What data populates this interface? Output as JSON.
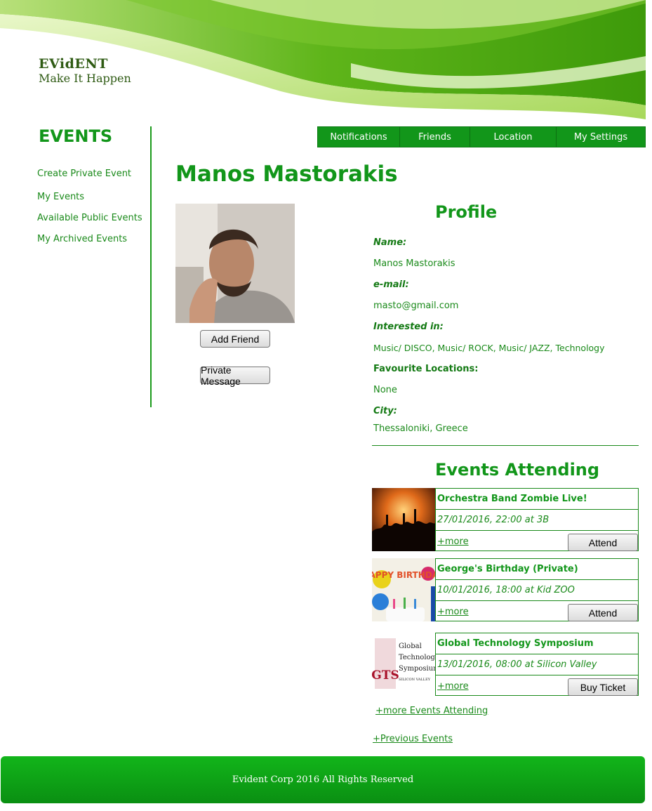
{
  "brand": {
    "name": "EVidENT",
    "tagline": "Make It Happen"
  },
  "sidebar": {
    "title": "EVENTS",
    "items": [
      {
        "label": "Create Private Event"
      },
      {
        "label": "My Events"
      },
      {
        "label": "Available Public Events"
      },
      {
        "label": "My Archived Events"
      }
    ]
  },
  "nav": {
    "items": [
      {
        "label": "Notifications"
      },
      {
        "label": "Friends"
      },
      {
        "label": "Location"
      },
      {
        "label": "My Settings"
      }
    ]
  },
  "user": {
    "name": "Manos Mastorakis",
    "add_friend_label": "Add Friend",
    "private_message_label": "Private Message"
  },
  "profile": {
    "title": "Profile",
    "fields": [
      {
        "label": "Name:",
        "value": "Manos Mastorakis"
      },
      {
        "label": "e-mail:",
        "value": "masto@gmail.com"
      },
      {
        "label": "Interested in:",
        "value": "Music/ DISCO, Music/ ROCK, Music/ JAZZ, Technology"
      },
      {
        "label": "Favourite Locations:",
        "value": "None"
      },
      {
        "label": "City:",
        "value": "Thessaloniki, Greece"
      }
    ]
  },
  "events_attending": {
    "title": "Events Attending",
    "events": [
      {
        "title": "Orchestra Band Zombie Live!",
        "when": "27/01/2016, 22:00 at 3B",
        "more": "+more",
        "action": "Attend"
      },
      {
        "title": "George's Birthday (Private)",
        "when": "10/01/2016, 18:00 at Kid ZOO",
        "more": "+more",
        "action": "Attend"
      },
      {
        "title": "Global Technology Symposium",
        "when": "13/01/2016, 08:00 at Silicon Valley",
        "more": "+more",
        "action": "Buy Ticket"
      }
    ],
    "gts_logo": {
      "abbr": "GTS",
      "lines": [
        "Global",
        "Technology",
        "Symposium",
        "SILICON VALLEY"
      ]
    },
    "birthday_logo": {
      "text": "HAPPY BIRTHDAY"
    },
    "more_events_label": "+more Events Attending",
    "previous_events_label": "+Previous Events"
  },
  "footer": {
    "text": "Evident Corp  2016 All Rights Reserved"
  },
  "colors": {
    "accent": "#12961a",
    "text_green": "#1a8a1a",
    "footer_green": "#0fa617"
  }
}
